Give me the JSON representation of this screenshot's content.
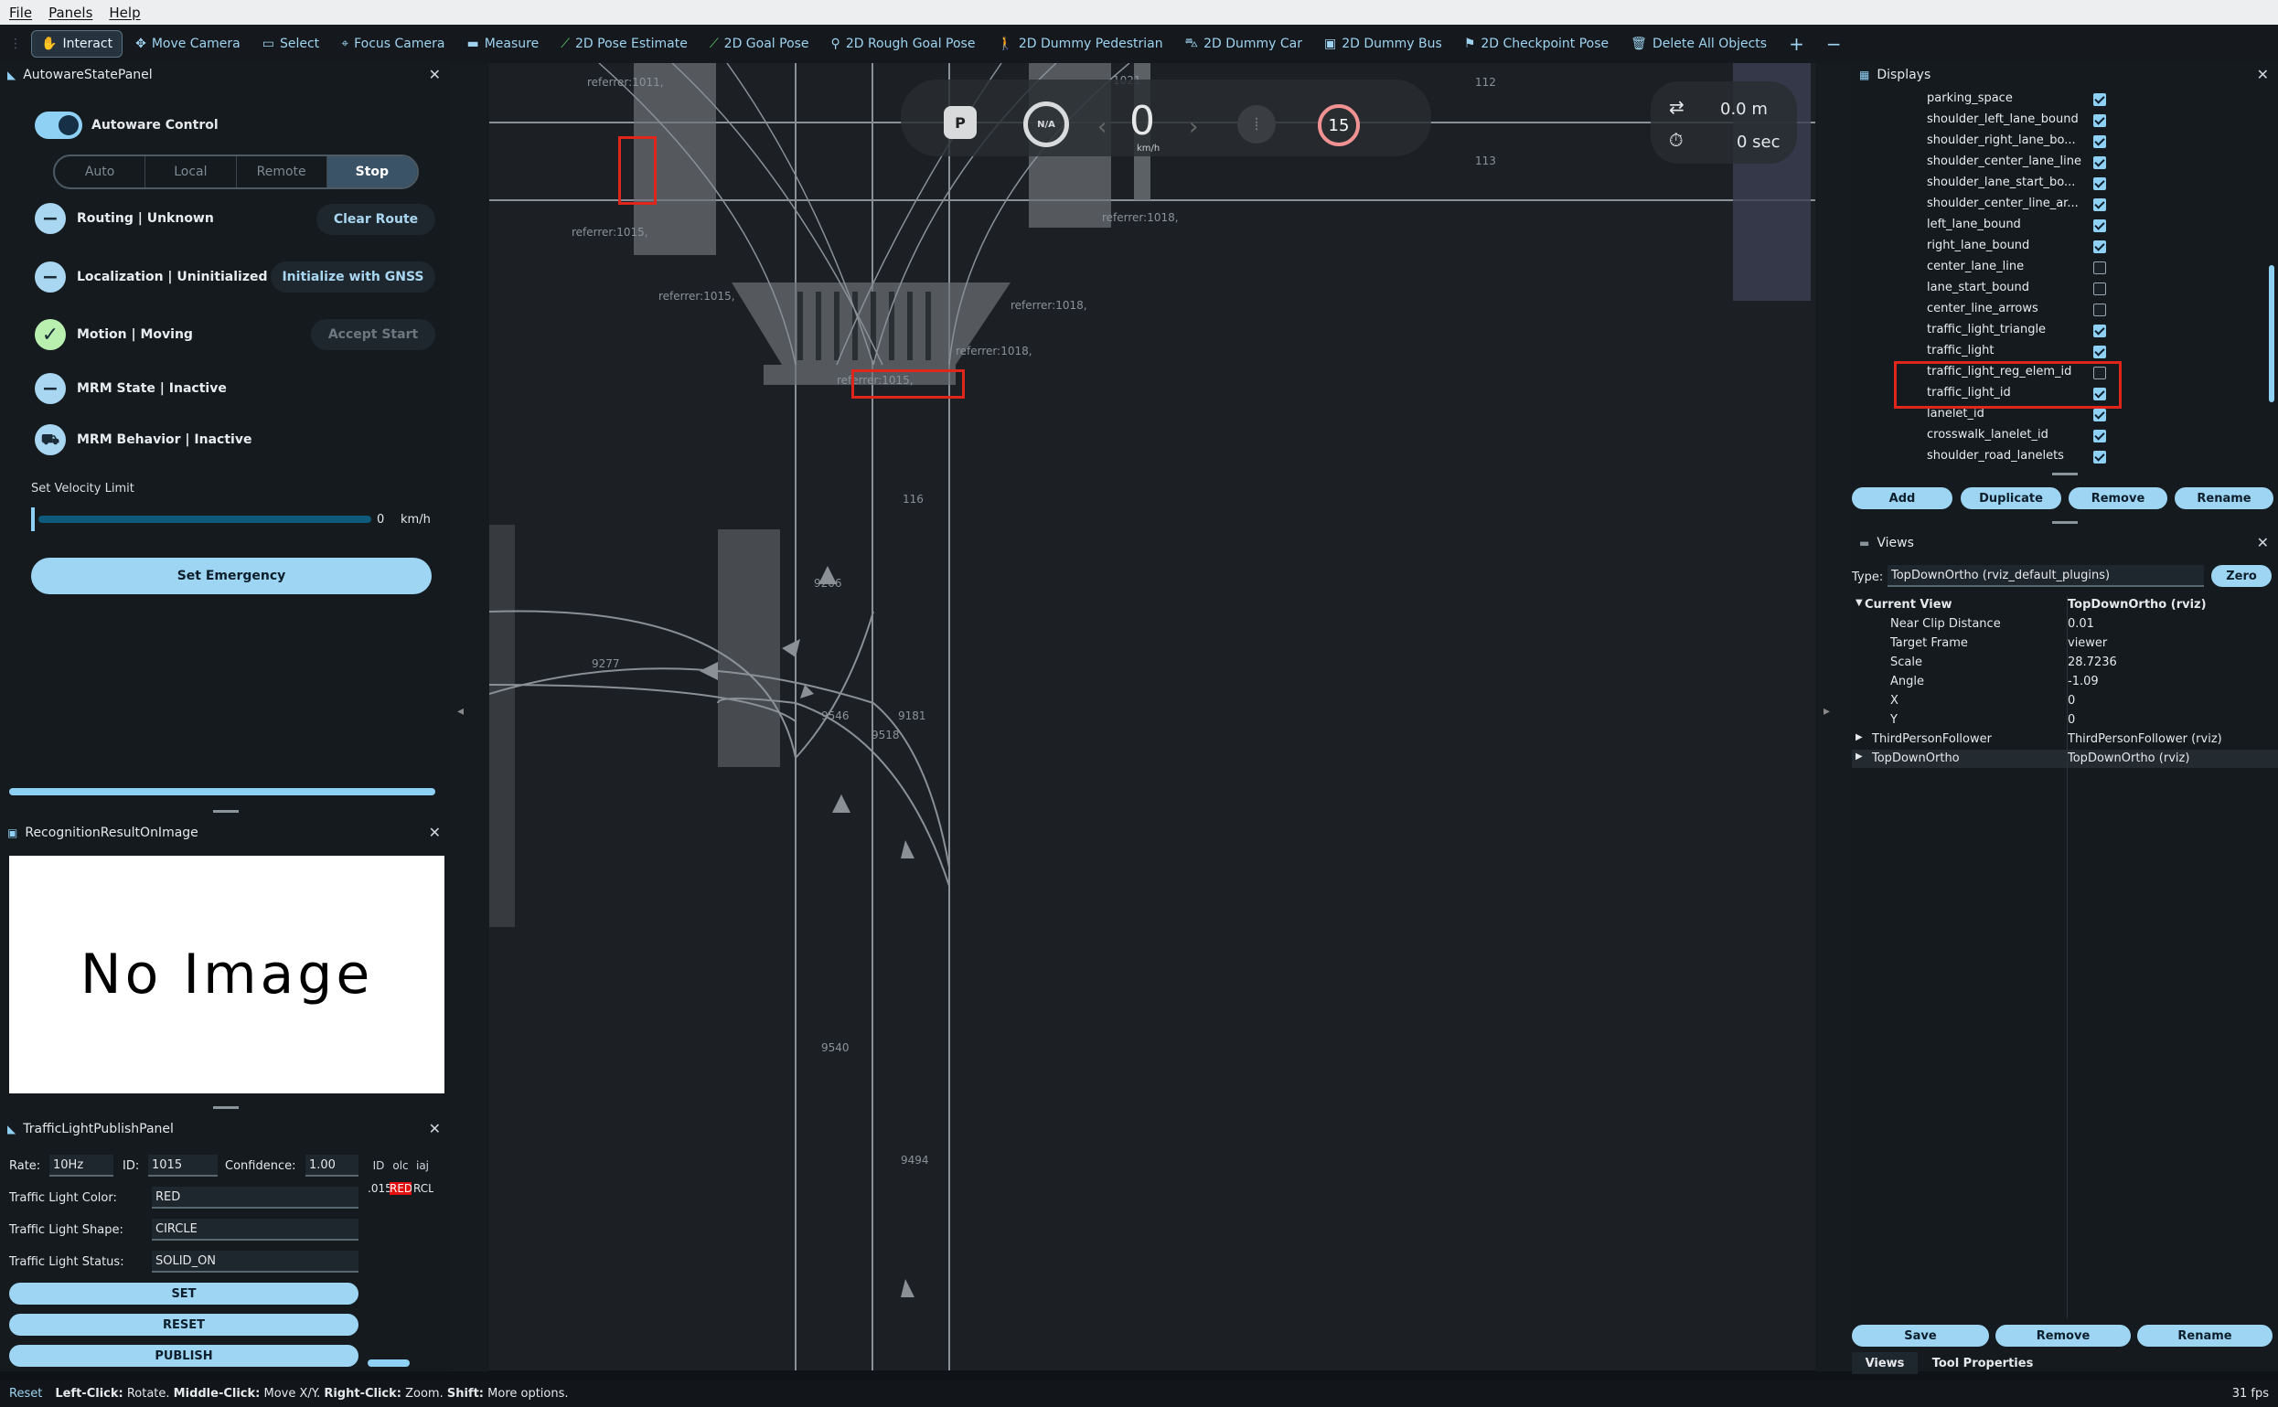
{
  "menu": [
    "File",
    "Panels",
    "Help"
  ],
  "toolbar": {
    "tools": [
      {
        "label": "Interact",
        "icon": "hand-icon",
        "active": true
      },
      {
        "label": "Move Camera",
        "icon": "move-icon"
      },
      {
        "label": "Select",
        "icon": "select-icon"
      },
      {
        "label": "Focus Camera",
        "icon": "focus-icon"
      },
      {
        "label": "Measure",
        "icon": "ruler-icon"
      },
      {
        "label": "2D Pose Estimate",
        "icon": "pose-icon"
      },
      {
        "label": "2D Goal Pose",
        "icon": "goal-icon"
      },
      {
        "label": "2D Rough Goal Pose",
        "icon": "pin-icon"
      },
      {
        "label": "2D Dummy Pedestrian",
        "icon": "pedestrian-icon"
      },
      {
        "label": "2D Dummy Car",
        "icon": "car-icon"
      },
      {
        "label": "2D Dummy Bus",
        "icon": "bus-icon"
      },
      {
        "label": "2D Checkpoint Pose",
        "icon": "flag-icon"
      },
      {
        "label": "Delete All Objects",
        "icon": "trash-icon"
      }
    ],
    "add_icon": "+",
    "remove_icon": "−"
  },
  "state_panel": {
    "title": "AutowareStatePanel",
    "control_label": "Autoware Control",
    "modes": [
      "Auto",
      "Local",
      "Remote",
      "Stop"
    ],
    "active_mode": "Stop",
    "routing": {
      "label": "Routing | Unknown",
      "button": "Clear Route"
    },
    "localization": {
      "label": "Localization | Uninitialized",
      "button": "Initialize with GNSS"
    },
    "motion": {
      "label": "Motion | Moving",
      "button": "Accept Start"
    },
    "mrm_state": "MRM State | Inactive",
    "mrm_behavior": "MRM Behavior | Inactive",
    "velocity_label": "Set Velocity Limit",
    "velocity_value": "0",
    "velocity_unit": "km/h",
    "emergency_button": "Set Emergency"
  },
  "recognition": {
    "title": "RecognitionResultOnImage",
    "no_image": "No Image"
  },
  "traffic_panel": {
    "title": "TrafficLightPublishPanel",
    "rate_label": "Rate:",
    "rate_value": "10Hz",
    "id_label": "ID:",
    "id_value": "1015",
    "conf_label": "Confidence:",
    "conf_value": "1.00",
    "color_label": "Traffic Light Color:",
    "color_value": "RED",
    "shape_label": "Traffic Light Shape:",
    "shape_value": "CIRCLE",
    "status_label": "Traffic Light Status:",
    "status_value": "SOLID_ON",
    "set": "SET",
    "reset": "RESET",
    "publish": "PUBLISH",
    "table_headers": [
      "ID",
      "olc",
      "iaj"
    ],
    "table_row": [
      ".015",
      "RED",
      "RCL"
    ]
  },
  "hud": {
    "gear": "P",
    "steer": "N/A",
    "speed": "0",
    "speed_unit": "km/h",
    "limit": "15",
    "distance": "0.0 m",
    "time": "0 sec"
  },
  "map_labels": {
    "r1": "referrer:1011,",
    "r2": "referrer:1018,",
    "r3": "referrer:1015,",
    "r4": "referrer:1015,",
    "r5": "referrer:1018,",
    "r6": "referrer:1018,",
    "r7": "referrer:1015,",
    "n112": "112",
    "n113": "113",
    "n116": "116",
    "n9277": "9277",
    "n9546": "9546",
    "n9518": "9518",
    "n9540": "9540",
    "n9494": "9494",
    "n9206": "9206",
    "n9181": "9181",
    "n1021": "1021"
  },
  "displays": {
    "title": "Displays",
    "items": [
      {
        "label": "parking_space",
        "checked": true
      },
      {
        "label": "shoulder_left_lane_bound",
        "checked": true
      },
      {
        "label": "shoulder_right_lane_bo...",
        "checked": true
      },
      {
        "label": "shoulder_center_lane_line",
        "checked": true
      },
      {
        "label": "shoulder_lane_start_bo...",
        "checked": true
      },
      {
        "label": "shoulder_center_line_ar...",
        "checked": true
      },
      {
        "label": "left_lane_bound",
        "checked": true
      },
      {
        "label": "right_lane_bound",
        "checked": true
      },
      {
        "label": "center_lane_line",
        "checked": false
      },
      {
        "label": "lane_start_bound",
        "checked": false
      },
      {
        "label": "center_line_arrows",
        "checked": false
      },
      {
        "label": "traffic_light_triangle",
        "checked": true
      },
      {
        "label": "traffic_light",
        "checked": true
      },
      {
        "label": "traffic_light_reg_elem_id",
        "checked": false
      },
      {
        "label": "traffic_light_id",
        "checked": true
      },
      {
        "label": "lanelet_id",
        "checked": true
      },
      {
        "label": "crosswalk_lanelet_id",
        "checked": true
      },
      {
        "label": "shoulder_road_lanelets",
        "checked": true
      }
    ],
    "buttons": [
      "Add",
      "Duplicate",
      "Remove",
      "Rename"
    ]
  },
  "views": {
    "title": "Views",
    "type_label": "Type:",
    "type_value": "TopDownOrtho (rviz_default_plugins)",
    "zero": "Zero",
    "rows": [
      {
        "k": "Current View",
        "v": "TopDownOrtho (rviz)",
        "bold": true
      },
      {
        "k": "Near Clip Distance",
        "v": "0.01"
      },
      {
        "k": "Target Frame",
        "v": "viewer"
      },
      {
        "k": "Scale",
        "v": "28.7236"
      },
      {
        "k": "Angle",
        "v": "-1.09"
      },
      {
        "k": "X",
        "v": "0"
      },
      {
        "k": "Y",
        "v": "0"
      },
      {
        "k": "ThirdPersonFollower",
        "v": "ThirdPersonFollower (rviz)"
      },
      {
        "k": "TopDownOrtho",
        "v": "TopDownOrtho (rviz)"
      }
    ],
    "buttons": [
      "Save",
      "Remove",
      "Rename"
    ],
    "tabs": [
      "Views",
      "Tool Properties"
    ]
  },
  "statusbar": {
    "reset": "Reset",
    "text_b1": "Left-Click:",
    "text_1": " Rotate. ",
    "text_b2": "Middle-Click:",
    "text_2": " Move X/Y. ",
    "text_b3": "Right-Click:",
    "text_3": " Zoom. ",
    "text_b4": "Shift:",
    "text_4": " More options.",
    "fps": "31 fps"
  }
}
